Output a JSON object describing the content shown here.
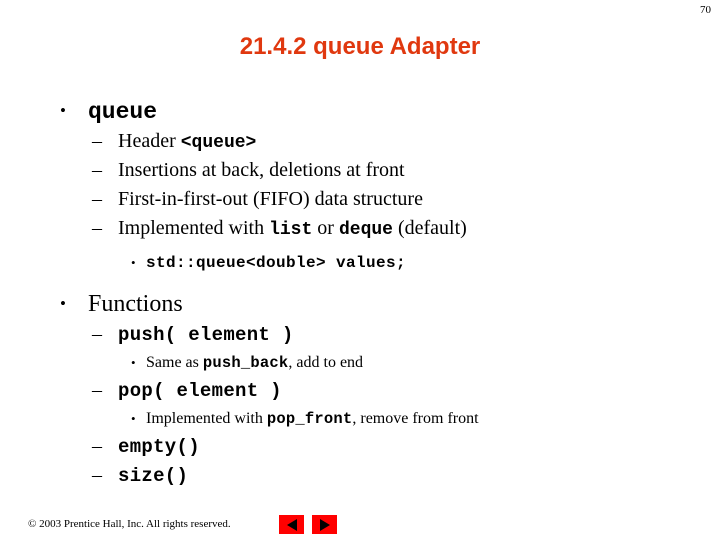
{
  "page_number": "70",
  "title": "21.4.2 queue Adapter",
  "colors": {
    "title": "#e0380f",
    "nav_button": "#ff0000",
    "text": "#000000",
    "background": "#ffffff"
  },
  "content": {
    "queue_heading": "queue",
    "queue_items": [
      {
        "pre": "Header ",
        "code": "<queue>",
        "post": ""
      },
      {
        "pre": "Insertions at back, deletions at front",
        "code": "",
        "post": ""
      },
      {
        "pre": "First-in-first-out (FIFO) data structure",
        "code": "",
        "post": ""
      },
      {
        "pre": "Implemented with ",
        "code": "list",
        "mid": " or ",
        "code2": "deque",
        "post": " (default)"
      }
    ],
    "queue_declaration": "std::queue<double> values;",
    "functions_heading": "Functions",
    "functions": [
      {
        "signature": "push( element )",
        "detail": {
          "pre": "Same as ",
          "code": "push_back",
          "post": ", add to end"
        }
      },
      {
        "signature": "pop( element )",
        "detail": {
          "pre": "Implemented with ",
          "code": "pop_front",
          "post": ", remove from front"
        }
      },
      {
        "signature": "empty()",
        "detail": null
      },
      {
        "signature": "size()",
        "detail": null
      }
    ]
  },
  "markers": {
    "bullet": "•",
    "dash": "–"
  },
  "footer": {
    "copyright": "© 2003 Prentice Hall, Inc.  All rights reserved.",
    "nav_prev_label": "Previous slide",
    "nav_next_label": "Next slide"
  }
}
